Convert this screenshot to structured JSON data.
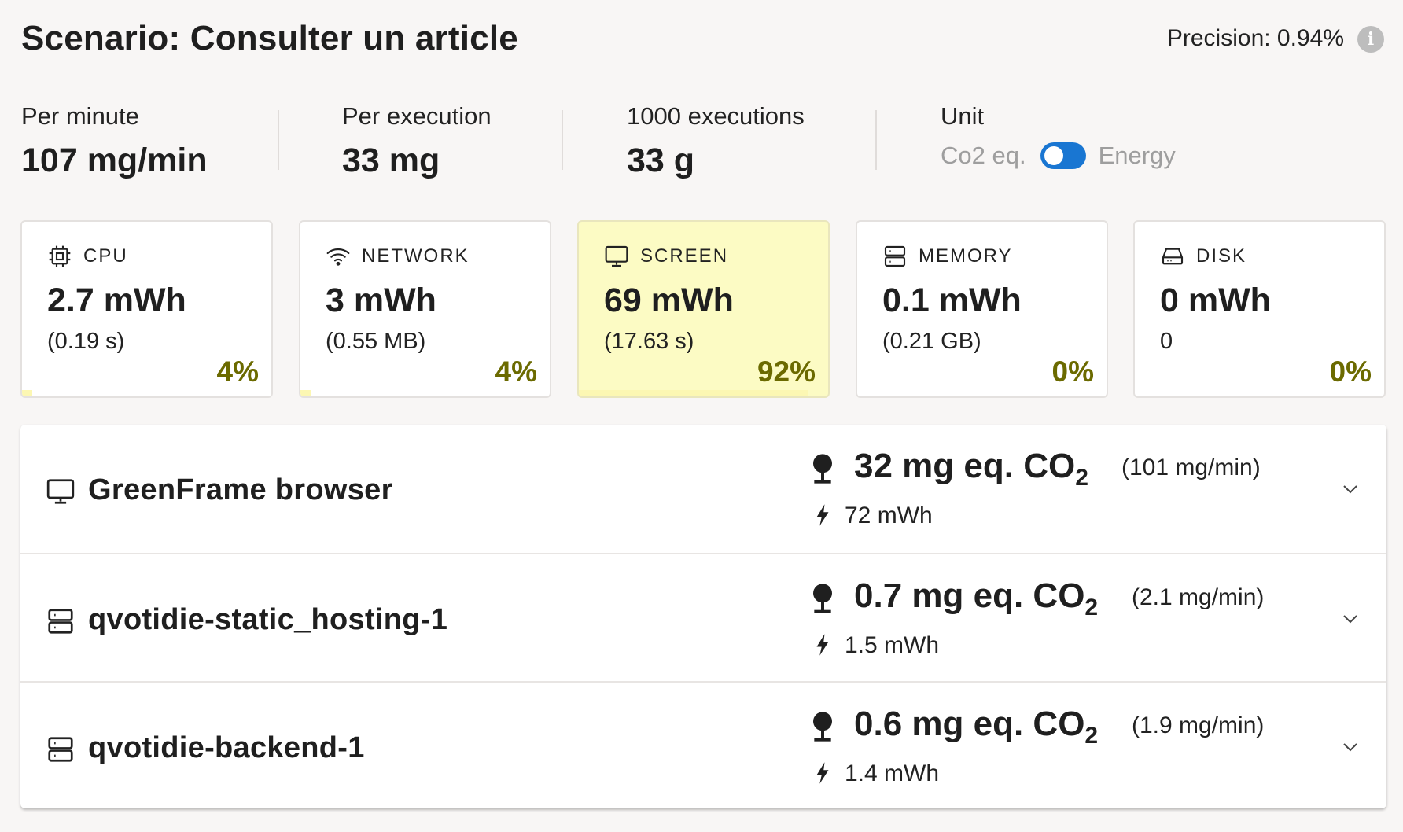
{
  "header": {
    "title": "Scenario: Consulter un article",
    "precision": "Precision: 0.94%",
    "info_icon": "info-icon"
  },
  "stats": [
    {
      "label": "Per minute",
      "value": "107 mg/min"
    },
    {
      "label": "Per execution",
      "value": "33 mg"
    },
    {
      "label": "1000 executions",
      "value": "33 g"
    }
  ],
  "unit": {
    "label": "Unit",
    "option_left": "Co2 eq.",
    "option_right": "Energy",
    "toggle_on": true
  },
  "cards": [
    {
      "name": "CPU",
      "icon": "cpu-icon",
      "energy": "2.7 mWh",
      "sub": "(0.19 s)",
      "percent": "4%",
      "share": 0.04
    },
    {
      "name": "NETWORK",
      "icon": "wifi-icon",
      "energy": "3 mWh",
      "sub": "(0.55 MB)",
      "percent": "4%",
      "share": 0.04
    },
    {
      "name": "SCREEN",
      "icon": "monitor-icon",
      "energy": "69 mWh",
      "sub": "(17.63 s)",
      "percent": "92%",
      "share": 0.92
    },
    {
      "name": "MEMORY",
      "icon": "memory-icon",
      "energy": "0.1 mWh",
      "sub": "(0.21 GB)",
      "percent": "0%",
      "share": 0.0
    },
    {
      "name": "DISK",
      "icon": "disk-icon",
      "energy": "0 mWh",
      "sub": "0",
      "percent": "0%",
      "share": 0.0
    }
  ],
  "containers": [
    {
      "name": "GreenFrame browser",
      "icon": "monitor-icon",
      "co2": "32 mg eq. CO",
      "co2_sub": "2",
      "rate": "(101 mg/min)",
      "energy": "72 mWh"
    },
    {
      "name": "qvotidie-static_hosting-1",
      "icon": "server-icon",
      "co2": "0.7 mg eq. CO",
      "co2_sub": "2",
      "rate": "(2.1 mg/min)",
      "energy": "1.5 mWh"
    },
    {
      "name": "qvotidie-backend-1",
      "icon": "server-icon",
      "co2": "0.6 mg eq. CO",
      "co2_sub": "2",
      "rate": "(1.9 mg/min)",
      "energy": "1.4 mWh"
    }
  ],
  "colors": {
    "accent": "#1976d2",
    "highlight": "#fcfbc4",
    "percent": "#6b6a00"
  }
}
